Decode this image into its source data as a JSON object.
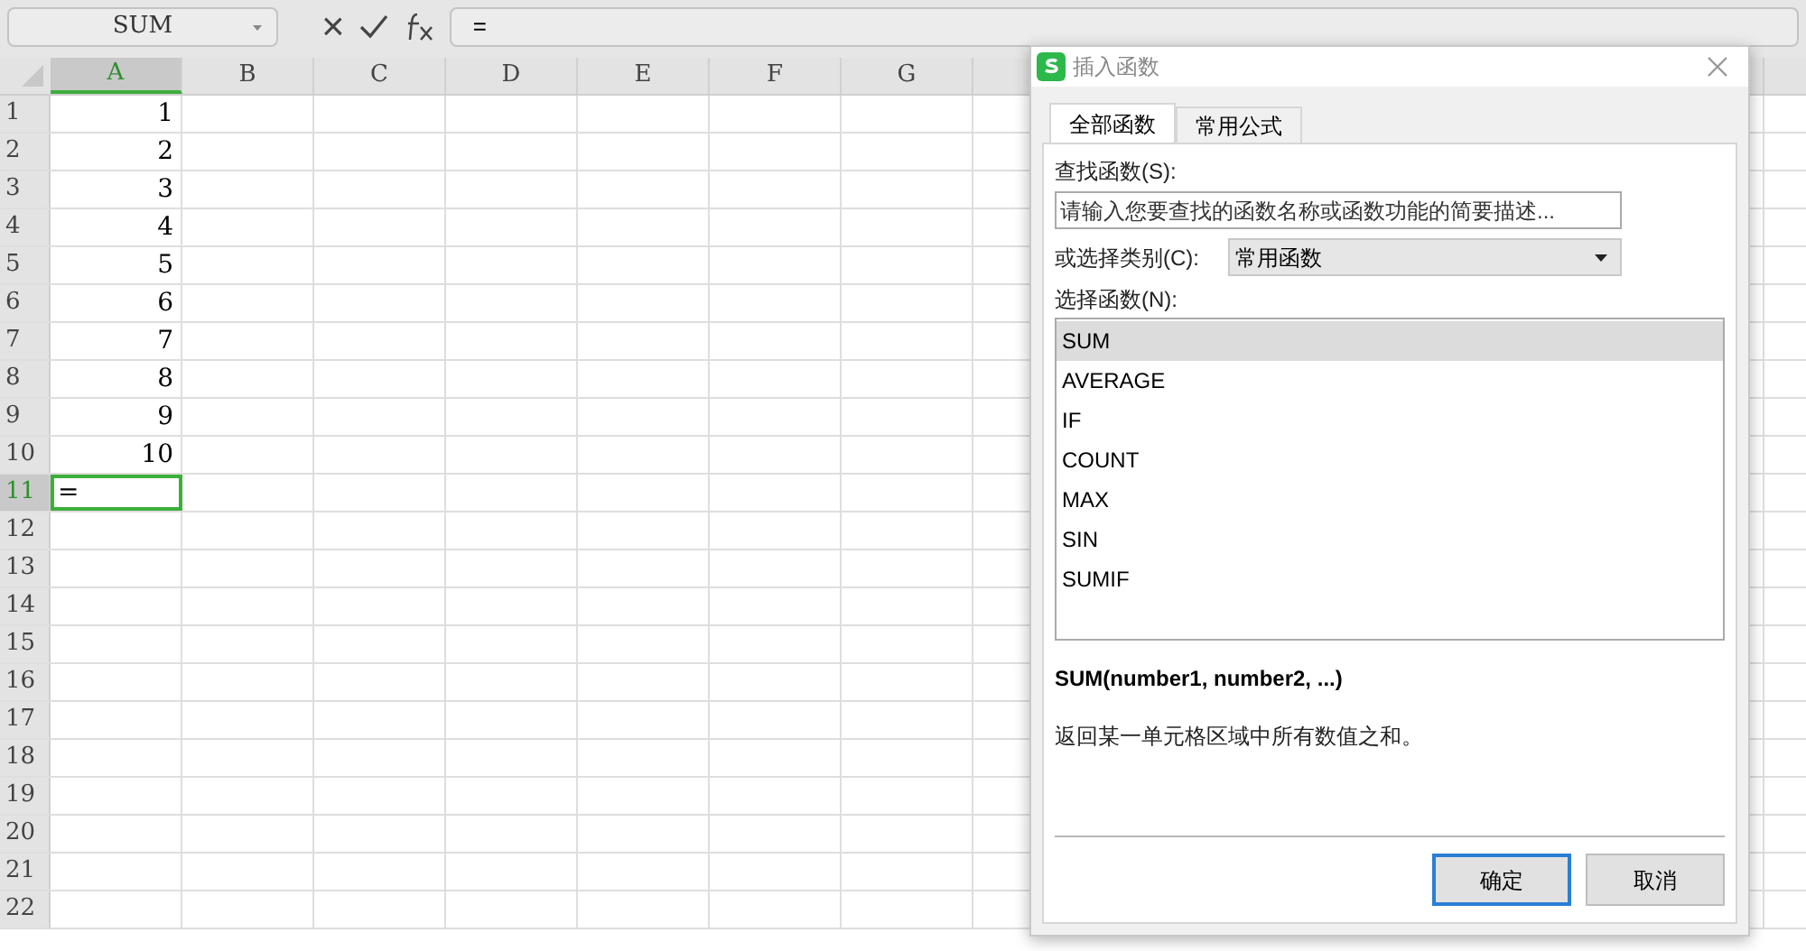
{
  "formula_bar": {
    "name_box": "SUM",
    "cancel": "×",
    "formula": "="
  },
  "sheet": {
    "columns": [
      {
        "label": "A",
        "selected": true
      },
      {
        "label": "B",
        "selected": false
      },
      {
        "label": "C",
        "selected": false
      },
      {
        "label": "D",
        "selected": false
      },
      {
        "label": "E",
        "selected": false
      },
      {
        "label": "F",
        "selected": false
      },
      {
        "label": "G",
        "selected": false
      }
    ],
    "rows": [
      {
        "label": "1",
        "a": "1",
        "selected": false
      },
      {
        "label": "2",
        "a": "2",
        "selected": false
      },
      {
        "label": "3",
        "a": "3",
        "selected": false
      },
      {
        "label": "4",
        "a": "4",
        "selected": false
      },
      {
        "label": "5",
        "a": "5",
        "selected": false
      },
      {
        "label": "6",
        "a": "6",
        "selected": false
      },
      {
        "label": "7",
        "a": "7",
        "selected": false
      },
      {
        "label": "8",
        "a": "8",
        "selected": false
      },
      {
        "label": "9",
        "a": "9",
        "selected": false
      },
      {
        "label": "10",
        "a": "10",
        "selected": false
      },
      {
        "label": "11",
        "a": "=",
        "selected": true
      },
      {
        "label": "12",
        "selected": false
      },
      {
        "label": "13",
        "selected": false
      },
      {
        "label": "14",
        "selected": false
      },
      {
        "label": "15",
        "selected": false
      },
      {
        "label": "16",
        "selected": false
      },
      {
        "label": "17",
        "selected": false
      },
      {
        "label": "18",
        "selected": false
      },
      {
        "label": "19",
        "selected": false
      },
      {
        "label": "20",
        "selected": false
      },
      {
        "label": "21",
        "selected": false
      },
      {
        "label": "22",
        "selected": false
      }
    ]
  },
  "dialog": {
    "title": "插入函数",
    "tabs": [
      {
        "label": "全部函数",
        "selected": true
      },
      {
        "label": "常用公式",
        "selected": false
      }
    ],
    "search_label": "查找函数(S):",
    "search_placeholder": "请输入您要查找的函数名称或函数功能的简要描述...",
    "category_label": "或选择类别(C):",
    "category": "常用函数",
    "list_label": "选择函数(N):",
    "functions": [
      {
        "name": "SUM",
        "selected": true
      },
      {
        "name": "AVERAGE",
        "selected": false
      },
      {
        "name": "IF",
        "selected": false
      },
      {
        "name": "COUNT",
        "selected": false
      },
      {
        "name": "MAX",
        "selected": false
      },
      {
        "name": "SIN",
        "selected": false
      },
      {
        "name": "SUMIF",
        "selected": false
      }
    ],
    "signature": "SUM(number1, number2, ...)",
    "description": "返回某一单元格区域中所有数值之和。",
    "buttons": [
      {
        "label": "确定",
        "kind": "primary"
      },
      {
        "label": "取消",
        "kind": "secondary"
      }
    ]
  }
}
